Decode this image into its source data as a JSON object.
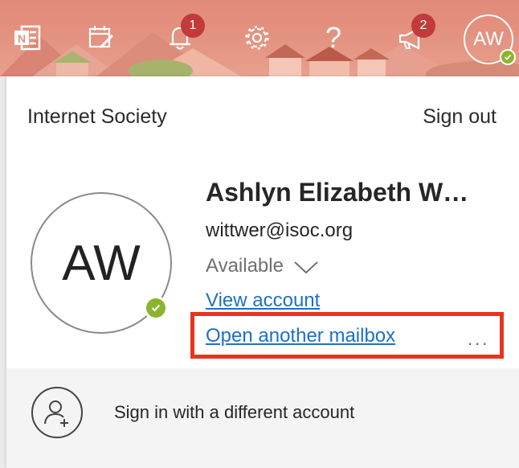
{
  "header": {
    "icons": [
      {
        "name": "onenote-icon"
      },
      {
        "name": "calendar-edit-icon"
      },
      {
        "name": "bell-icon",
        "badge": "1"
      },
      {
        "name": "gear-icon"
      },
      {
        "name": "help-icon",
        "glyph": "?"
      },
      {
        "name": "megaphone-icon",
        "badge": "2"
      }
    ],
    "me_initials": "AW",
    "presence_color": "#8bb42f",
    "badge_color": "#c23a3a"
  },
  "account_panel": {
    "org_name": "Internet Society",
    "sign_out_label": "Sign out",
    "avatar_initials": "AW",
    "display_name": "Ashlyn Elizabeth W…",
    "email": "wittwer@isoc.org",
    "presence": "Available",
    "view_account_label": "View account",
    "open_mailbox_label": "Open another mailbox",
    "more_label": "...",
    "switch_account_label": "Sign in with a different account",
    "link_color": "#1f6fc5",
    "highlight_color": "#e8341c"
  }
}
